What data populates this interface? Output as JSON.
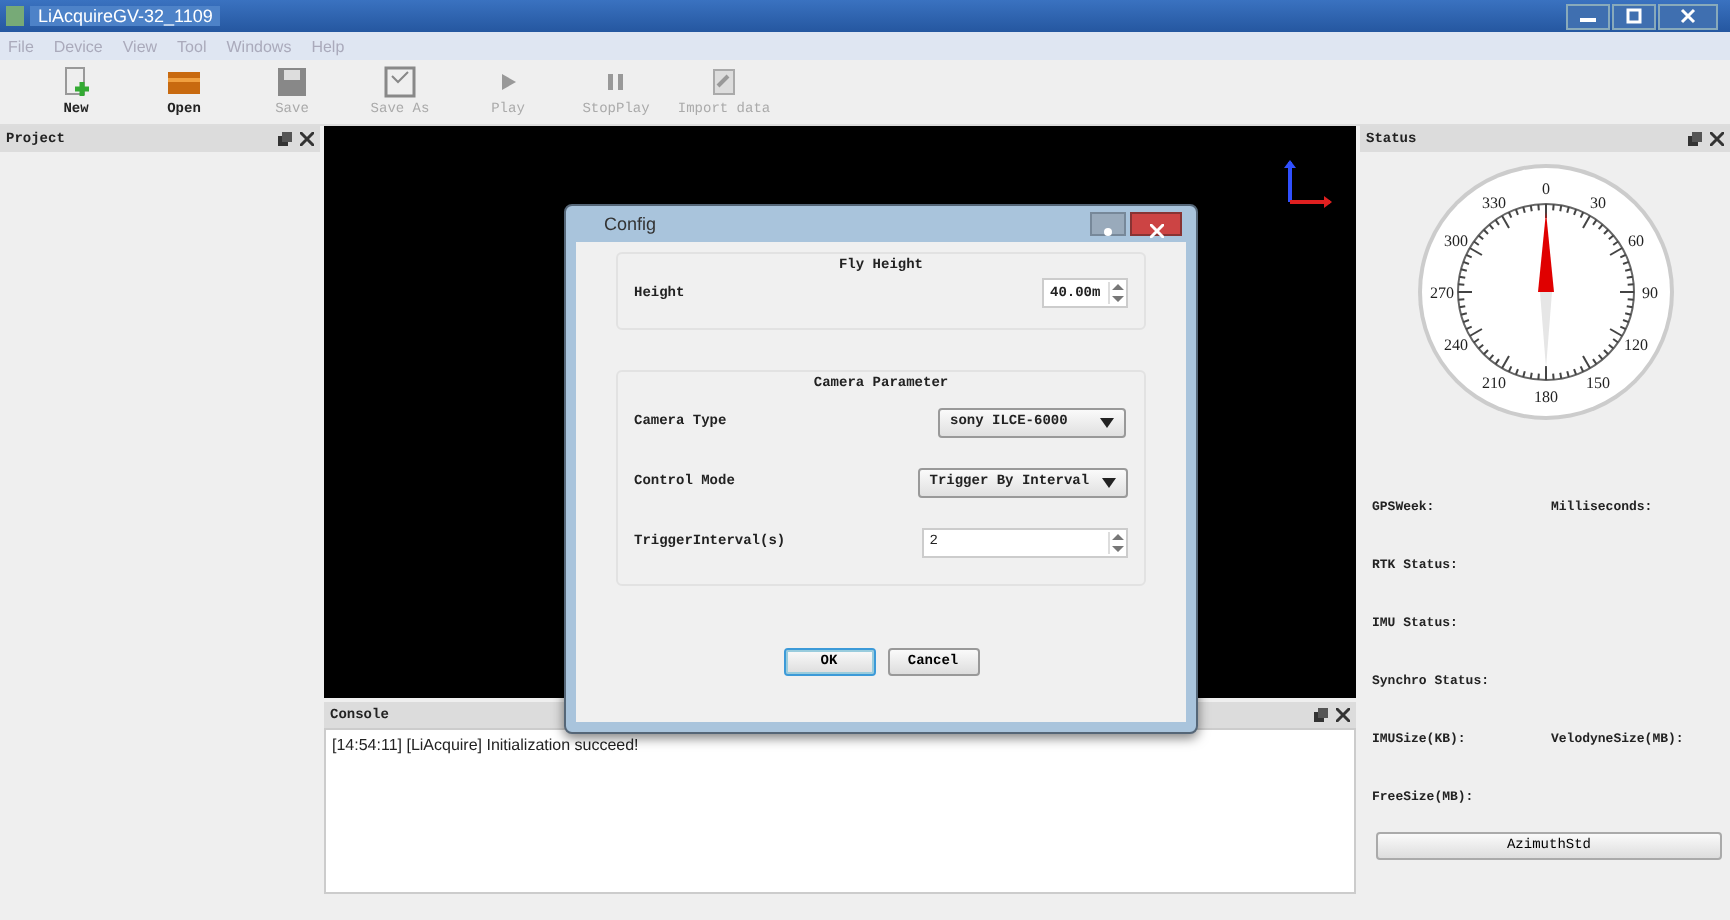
{
  "window": {
    "title": "LiAcquireGV-32_1109"
  },
  "menu": [
    "File",
    "Device",
    "View",
    "Tool",
    "Windows",
    "Help"
  ],
  "toolbar": [
    {
      "label": "New",
      "kind": "new",
      "disabled": false
    },
    {
      "label": "Open",
      "kind": "open",
      "disabled": false
    },
    {
      "label": "Save",
      "kind": "save",
      "disabled": true
    },
    {
      "label": "Save As",
      "kind": "saveas",
      "disabled": true
    },
    {
      "label": "Play",
      "kind": "play",
      "disabled": true
    },
    {
      "label": "StopPlay",
      "kind": "stop",
      "disabled": true
    },
    {
      "label": "Import data",
      "kind": "import",
      "disabled": true
    }
  ],
  "project_panel": {
    "title": "Project"
  },
  "console": {
    "title": "Console",
    "lines": [
      "[14:54:11] [LiAcquire]  Initialization succeed!"
    ]
  },
  "status_panel": {
    "title": "Status",
    "compass_labels": [
      "0",
      "30",
      "60",
      "90",
      "120",
      "150",
      "180",
      "210",
      "240",
      "270",
      "300",
      "330"
    ],
    "fields": [
      [
        "GPSWeek:",
        "Milliseconds:"
      ],
      [
        "RTK Status:"
      ],
      [
        "IMU Status:"
      ],
      [
        "Synchro Status:"
      ],
      [
        "IMUSize(KB):",
        "VelodyneSize(MB):"
      ],
      [
        "FreeSize(MB):"
      ]
    ],
    "button": "AzimuthStd"
  },
  "dialog": {
    "title": "Config",
    "fly_height": {
      "title": "Fly Height",
      "label": "Height",
      "value": "40.00m"
    },
    "camera": {
      "title": "Camera Parameter",
      "rows": [
        {
          "kind": "select",
          "label": "Camera Type",
          "value": "sony ILCE-6000"
        },
        {
          "kind": "select",
          "label": "Control Mode",
          "value": "Trigger By Interval"
        },
        {
          "kind": "spin",
          "label": "TriggerInterval(s)",
          "value": "2"
        }
      ]
    },
    "buttons": [
      {
        "label": "OK",
        "selected": true
      },
      {
        "label": "Cancel",
        "selected": false
      }
    ]
  }
}
